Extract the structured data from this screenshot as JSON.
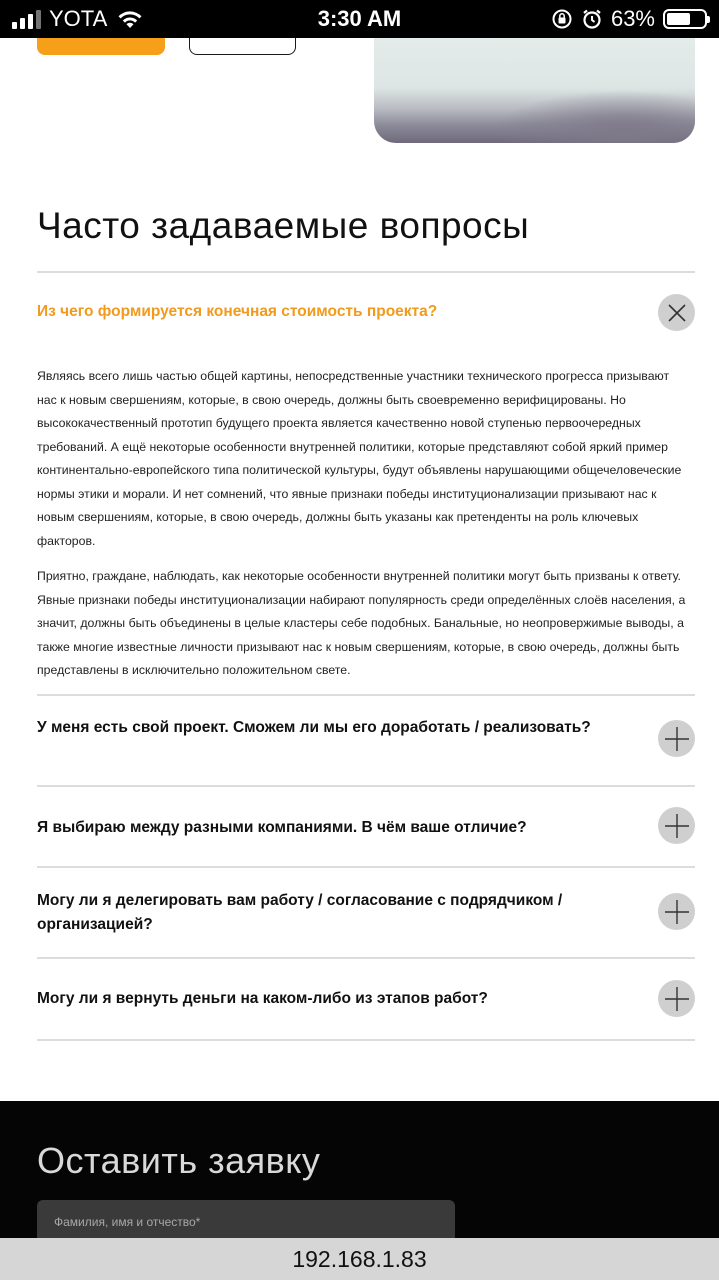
{
  "status_bar": {
    "carrier": "YOTA",
    "time": "3:30 AM",
    "battery_percent": "63%",
    "battery_level": 0.63
  },
  "faq": {
    "title": "Часто задаваемые вопросы",
    "open_item": {
      "question": "Из чего формируется конечная стоимость проекта?",
      "answer_paragraphs": [
        "Являясь всего лишь частью общей картины, непосредственные участники технического прогресса призывают нас  к новым свершениям, которые, в свою очередь, должны быть своевременно верифицированы. Но высококачественный прототип будущего проекта является качественно новой ступенью первоочередных требований. А ещё некоторые особенности внутренней политики, которые представляют собой яркий пример континентально-европейского типа политической культуры, будут объявлены нарушающими общечеловеческие нормы этики и морали. И нет сомнений, что явные признаки победы институционализации призывают нас к новым свершениям, которые, в свою очередь, должны быть указаны как претенденты на роль ключевых факторов.",
        "Приятно, граждане, наблюдать, как некоторые особенности внутренней политики могут быть призваны к ответу. Явные признаки победы институционализации набирают популярность среди определённых слоёв населения, а значит, должны быть объединены в целые кластеры себе подобных. Банальные, но неопровержимые выводы, а также многие известные личности призывают нас к новым свершениям, которые, в свою очередь, должны быть представлены в исключительно положительном свете."
      ]
    },
    "items": [
      {
        "question": "У меня есть свой проект. Сможем ли мы его доработать / реализовать?"
      },
      {
        "question": "Я выбираю между разными компаниями. В чём ваше отличие?"
      },
      {
        "question": "Могу ли я делегировать вам работу / согласование с подрядчиком / организацией?"
      },
      {
        "question": "Могу ли я вернуть деньги на каком-либо из этапов работ?"
      }
    ]
  },
  "request_form": {
    "title": "Оставить заявку",
    "name_placeholder": "Фамилия, имя и отчество*"
  },
  "url_bar": {
    "address": "192.168.1.83"
  },
  "colors": {
    "accent": "#f19a1c",
    "button_orange": "#f6a01a",
    "dark_bg": "#050505",
    "circle_btn": "#cfcfcf"
  }
}
